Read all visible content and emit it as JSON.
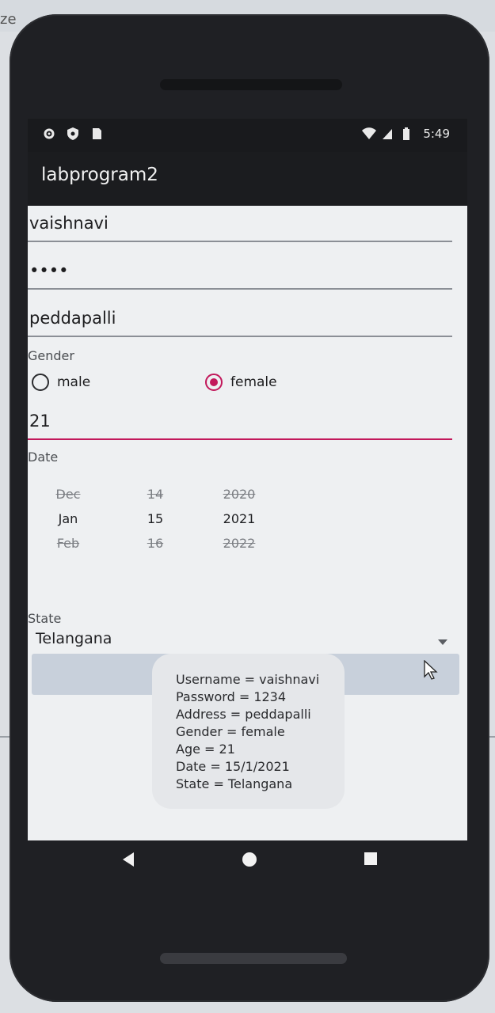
{
  "desktop": {
    "corner_text": "ze"
  },
  "status_bar": {
    "time": "5:49"
  },
  "app_bar": {
    "title": "labprogram2"
  },
  "form": {
    "username_value": "vaishnavi",
    "password_value": "••••",
    "address_value": "peddapalli",
    "gender_label": "Gender",
    "gender_options": [
      {
        "label": "male",
        "checked": false
      },
      {
        "label": "female",
        "checked": true
      }
    ],
    "age_value": "21",
    "date_label": "Date",
    "date_picker": {
      "month": {
        "prev": "Dec",
        "current": "Jan",
        "next": "Feb"
      },
      "day": {
        "prev": "14",
        "current": "15",
        "next": "16"
      },
      "year": {
        "prev": "2020",
        "current": "2021",
        "next": "2022"
      }
    },
    "state_label": "State",
    "state_value": "Telangana"
  },
  "toast": {
    "lines": [
      "Username = vaishnavi",
      "Password = 1234",
      "Address = peddapalli",
      "Gender = female",
      "Age = 21",
      "Date = 15/1/2021",
      "State = Telangana"
    ]
  },
  "colors": {
    "accent": "#c2185b",
    "app_bar_bg": "#1b1c1f",
    "screen_bg": "#eef0f2"
  },
  "icons": {
    "status_left": [
      "settings-icon",
      "shield-icon",
      "sim-icon"
    ],
    "status_right": [
      "wifi-icon",
      "signal-icon",
      "battery-icon"
    ],
    "nav": [
      "back-icon",
      "home-icon",
      "recents-icon"
    ]
  }
}
